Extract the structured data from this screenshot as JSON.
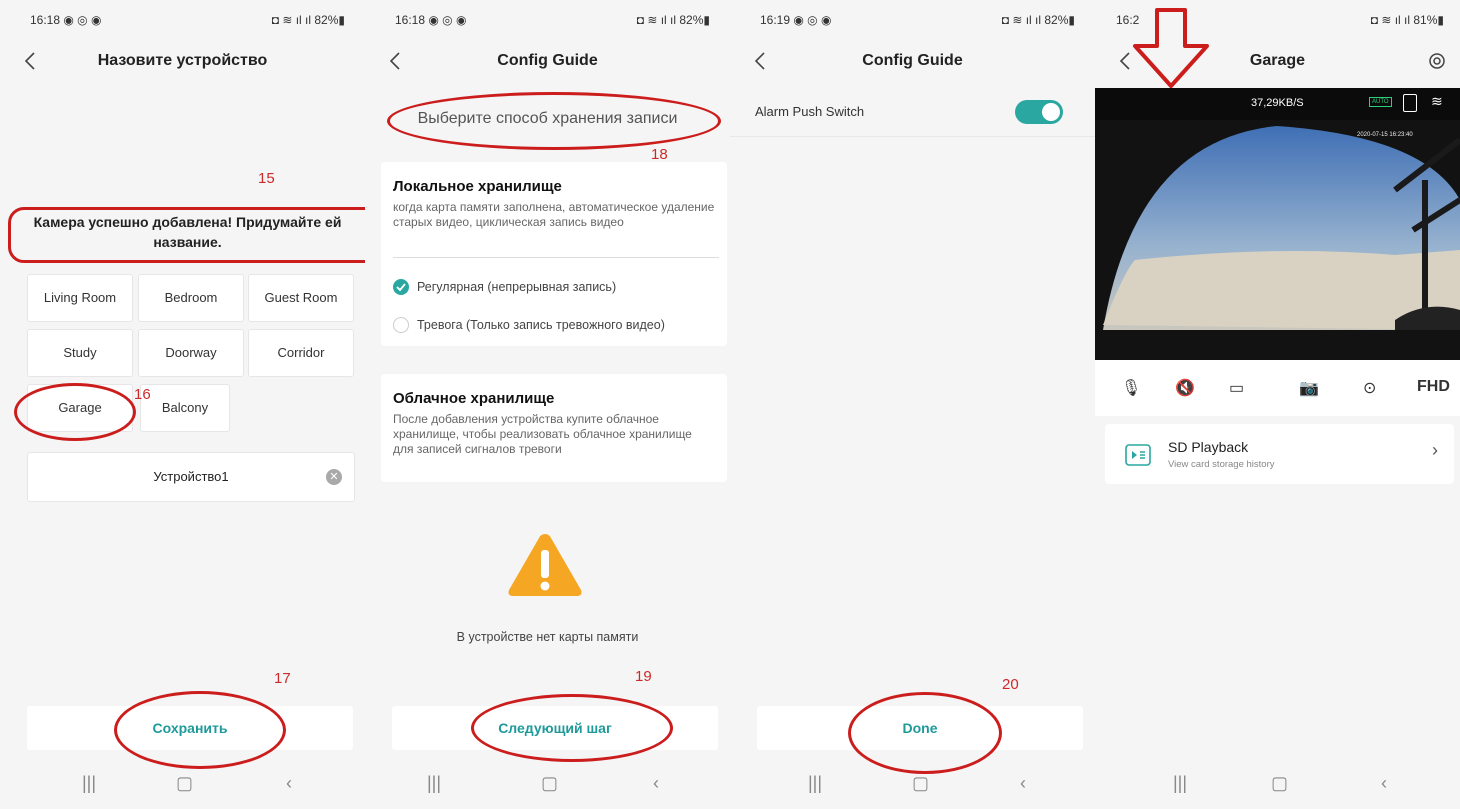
{
  "panels": [
    {
      "status": {
        "time": "16:18 ◉ ◎ ◉",
        "right": "◘ ≋ ıl ıl 82%▮"
      },
      "header": {
        "title": "Назовите устройство"
      },
      "annotation_15": "15",
      "message": "Камера успешно добавлена! Придумайте ей название.",
      "rooms": [
        "Living Room",
        "Bedroom",
        "Guest Room",
        "Study",
        "Doorway",
        "Corridor",
        "Garage",
        "Balcony"
      ],
      "annotation_16": "16",
      "name_field": {
        "value": "Устройство1"
      },
      "annotation_17": "17",
      "save_label": "Сохранить"
    },
    {
      "status": {
        "time": "16:18 ◉ ◎ ◉",
        "right": "◘ ≋ ıl ıl 82%▮"
      },
      "header": {
        "title": "Config Guide"
      },
      "storage_title": "Выберите способ хранения записи",
      "annotation_18": "18",
      "local": {
        "title": "Локальное хранилище",
        "desc": "когда карта памяти заполнена, автоматическое удаление старых видео, циклическая запись видео",
        "option1": "Регулярная (непрерывная запись)",
        "option2": "Тревога (Только запись тревожного видео)"
      },
      "cloud": {
        "title": "Облачное хранилище",
        "desc": "После добавления устройства купите облачное хранилище, чтобы реализовать облачное хранилище для записей сигналов тревоги"
      },
      "no_card": "В устройстве нет карты памяти",
      "annotation_19": "19",
      "next_label": "Следующий шаг"
    },
    {
      "status": {
        "time": "16:19 ◉ ◎ ◉",
        "right": "◘ ≋ ıl ıl 82%▮"
      },
      "header": {
        "title": "Config Guide"
      },
      "alarm_label": "Alarm Push Switch",
      "annotation_20": "20",
      "done_label": "Done"
    },
    {
      "status": {
        "time": "16:2",
        "right": "◘ ≋ ıl ıl 81%▮"
      },
      "header": {
        "title": "Garage"
      },
      "speed": "37,29KB/S",
      "auto": "AUTO",
      "timestamp": "2020-07-15 16:23:40",
      "quality": "FHD",
      "sd": {
        "title": "SD Playback",
        "subtitle": "View card storage history"
      }
    }
  ],
  "colors": {
    "accent": "#2aa7a0",
    "annotation": "#cc1d1d",
    "warning": "#f5a623"
  }
}
